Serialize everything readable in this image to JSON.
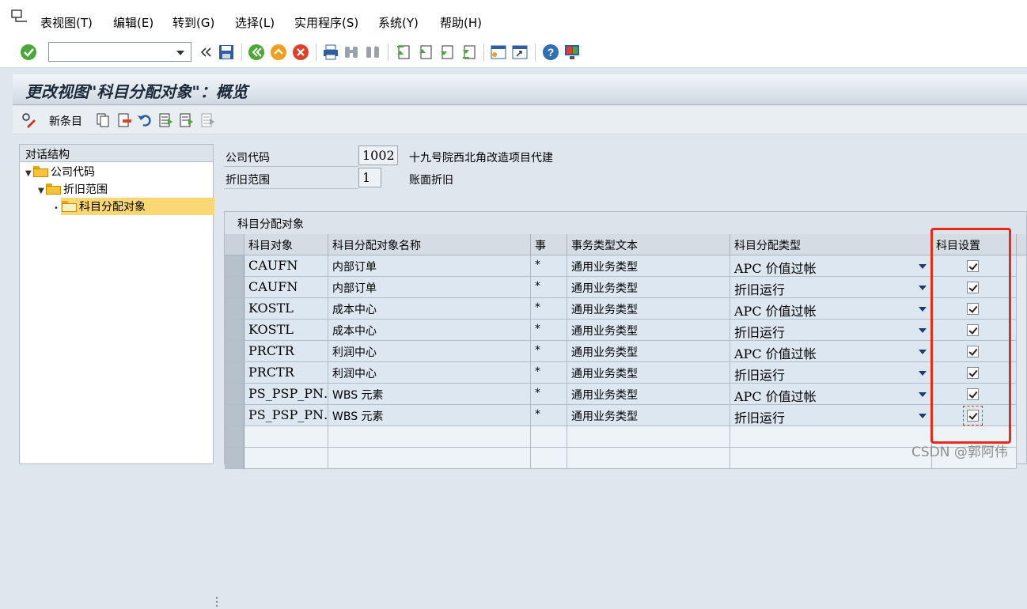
{
  "menu": {
    "items": [
      {
        "label": "表视图(T)"
      },
      {
        "label": "编辑(E)"
      },
      {
        "label": "转到(G)"
      },
      {
        "label": "选择(L)"
      },
      {
        "label": "实用程序(S)"
      },
      {
        "label": "系统(Y)"
      },
      {
        "label": "帮助(H)"
      }
    ]
  },
  "command_field": {
    "value": ""
  },
  "page_title": "更改视图\"科目分配对象\"：概览",
  "app_toolbar": {
    "new_entries_label": "新条目"
  },
  "tree": {
    "header": "对话结构",
    "nodes": [
      {
        "label": "公司代码"
      },
      {
        "label": "折旧范围"
      },
      {
        "label": "科目分配对象"
      }
    ]
  },
  "header_fields": {
    "company_code": {
      "label": "公司代码",
      "value": "1002",
      "text": "十九号院西北角改造项目代建"
    },
    "depreciation_area": {
      "label": "折旧范围",
      "value": "1",
      "text": "账面折旧"
    }
  },
  "table": {
    "caption": "科目分配对象",
    "columns": [
      "科目对象",
      "科目分配对象名称",
      "事",
      "事务类型文本",
      "科目分配类型",
      "科目设置"
    ],
    "rows": [
      {
        "object": "CAUFN",
        "name": "内部订单",
        "trans": "*",
        "trans_text": "通用业务类型",
        "type": "APC 价值过帐",
        "checked": true
      },
      {
        "object": "CAUFN",
        "name": "内部订单",
        "trans": "*",
        "trans_text": "通用业务类型",
        "type": "折旧运行",
        "checked": true
      },
      {
        "object": "KOSTL",
        "name": "成本中心",
        "trans": "*",
        "trans_text": "通用业务类型",
        "type": "APC 价值过帐",
        "checked": true
      },
      {
        "object": "KOSTL",
        "name": "成本中心",
        "trans": "*",
        "trans_text": "通用业务类型",
        "type": "折旧运行",
        "checked": true
      },
      {
        "object": "PRCTR",
        "name": "利润中心",
        "trans": "*",
        "trans_text": "通用业务类型",
        "type": "APC 价值过帐",
        "checked": true
      },
      {
        "object": "PRCTR",
        "name": "利润中心",
        "trans": "*",
        "trans_text": "通用业务类型",
        "type": "折旧运行",
        "checked": true
      },
      {
        "object": "PS_PSP_PN…",
        "name": "WBS 元素",
        "trans": "*",
        "trans_text": "通用业务类型",
        "type": "APC 价值过帐",
        "checked": true
      },
      {
        "object": "PS_PSP_PN…",
        "name": "WBS 元素",
        "trans": "*",
        "trans_text": "通用业务类型",
        "type": "折旧运行",
        "checked": true
      }
    ]
  },
  "watermark": "CSDN @郭阿伟",
  "colors": {
    "highlight": "#e8291c",
    "title_bg": "#cfd8e2",
    "row_bg": "#dce7f1"
  }
}
